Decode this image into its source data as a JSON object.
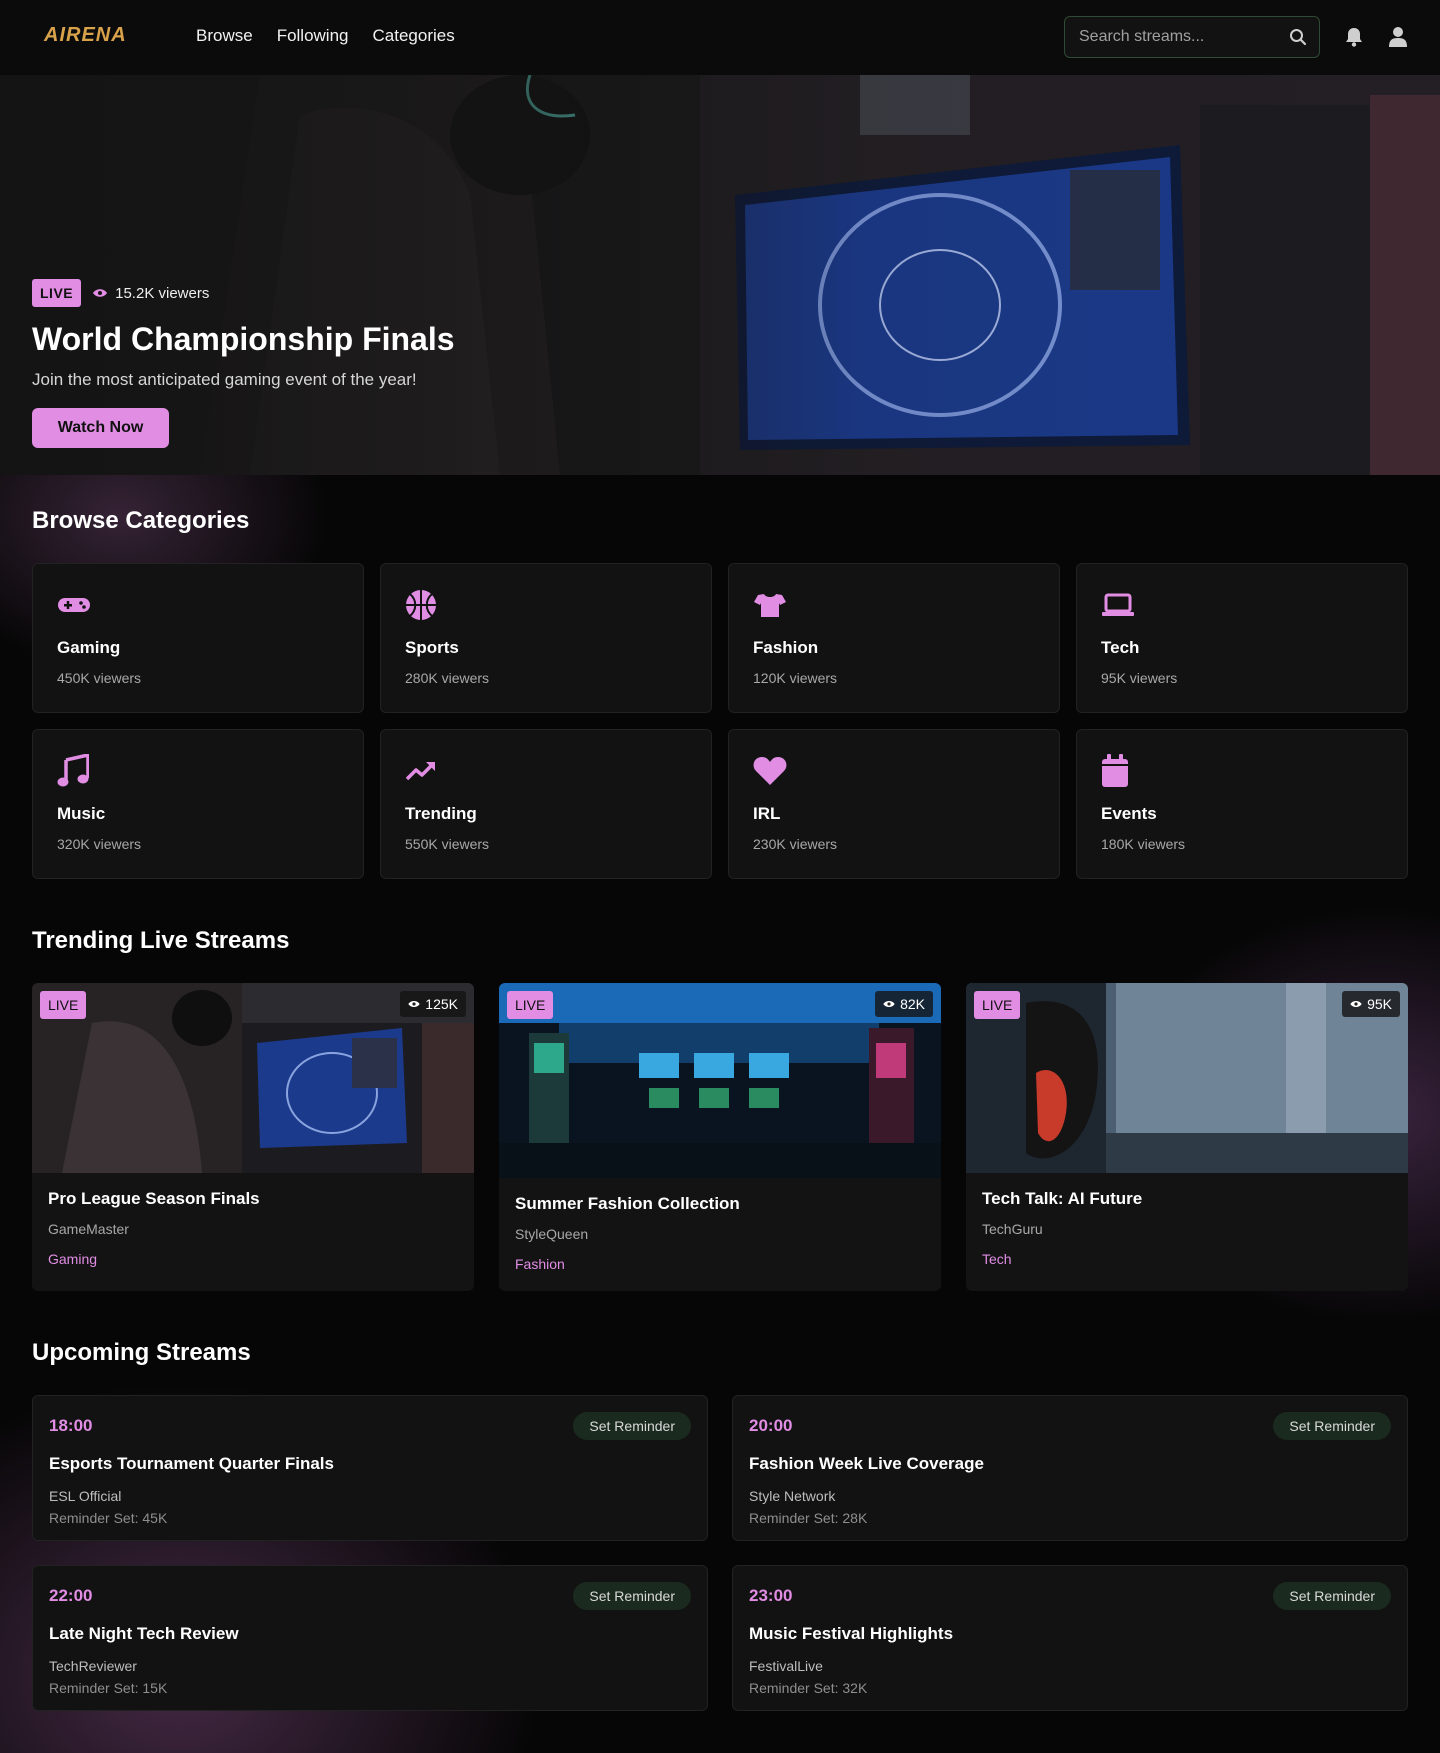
{
  "brand": {
    "logo_text": "AIRENA",
    "accent": "#e18de4"
  },
  "nav": {
    "links": [
      "Browse",
      "Following",
      "Categories"
    ]
  },
  "search": {
    "placeholder": "Search streams..."
  },
  "hero": {
    "live_label": "LIVE",
    "viewers": "15.2K viewers",
    "title": "World Championship Finals",
    "subtitle": "Join the most anticipated gaming event of the year!",
    "cta": "Watch Now"
  },
  "categories": {
    "title": "Browse Categories",
    "items": [
      {
        "name": "Gaming",
        "viewers": "450K viewers",
        "icon": "gamepad-icon"
      },
      {
        "name": "Sports",
        "viewers": "280K viewers",
        "icon": "basketball-icon"
      },
      {
        "name": "Fashion",
        "viewers": "120K viewers",
        "icon": "shirt-icon"
      },
      {
        "name": "Tech",
        "viewers": "95K viewers",
        "icon": "laptop-icon"
      },
      {
        "name": "Music",
        "viewers": "320K viewers",
        "icon": "music-note-icon"
      },
      {
        "name": "Trending",
        "viewers": "550K viewers",
        "icon": "trend-up-icon"
      },
      {
        "name": "IRL",
        "viewers": "230K viewers",
        "icon": "heart-icon"
      },
      {
        "name": "Events",
        "viewers": "180K viewers",
        "icon": "calendar-icon"
      }
    ]
  },
  "trending": {
    "title": "Trending Live Streams",
    "items": [
      {
        "live_label": "LIVE",
        "views": "125K",
        "title": "Pro League Season Finals",
        "streamer": "GameMaster",
        "category": "Gaming"
      },
      {
        "live_label": "LIVE",
        "views": "82K",
        "title": "Summer Fashion Collection",
        "streamer": "StyleQueen",
        "category": "Fashion"
      },
      {
        "live_label": "LIVE",
        "views": "95K",
        "title": "Tech Talk: AI Future",
        "streamer": "TechGuru",
        "category": "Tech"
      }
    ]
  },
  "upcoming": {
    "title": "Upcoming Streams",
    "button_label": "Set Reminder",
    "items": [
      {
        "time": "18:00",
        "title": "Esports Tournament Quarter Finals",
        "channel": "ESL Official",
        "reminders": "Reminder Set: 45K"
      },
      {
        "time": "20:00",
        "title": "Fashion Week Live Coverage",
        "channel": "Style Network",
        "reminders": "Reminder Set: 28K"
      },
      {
        "time": "22:00",
        "title": "Late Night Tech Review",
        "channel": "TechReviewer",
        "reminders": "Reminder Set: 15K"
      },
      {
        "time": "23:00",
        "title": "Music Festival Highlights",
        "channel": "FestivalLive",
        "reminders": "Reminder Set: 32K"
      }
    ]
  }
}
